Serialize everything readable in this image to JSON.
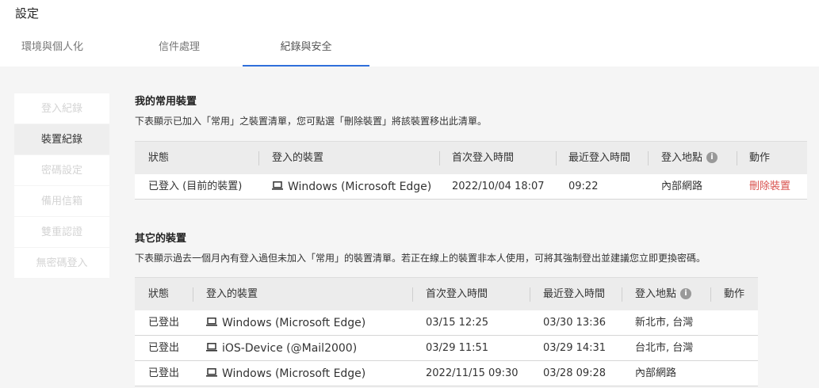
{
  "page_title": "設定",
  "tabs": [
    {
      "label": "環境與個人化"
    },
    {
      "label": "信件處理"
    },
    {
      "label": "紀錄與安全"
    }
  ],
  "side_nav": [
    {
      "label": "登入紀錄"
    },
    {
      "label": "裝置紀錄"
    },
    {
      "label": "密碼設定"
    },
    {
      "label": "備用信箱"
    },
    {
      "label": "雙重認證"
    },
    {
      "label": "無密碼登入"
    }
  ],
  "common": {
    "title": "我的常用裝置",
    "desc": "下表顯示已加入「常用」之裝置清單，您可點選「刪除裝置」將該裝置移出此清單。",
    "headers": {
      "status": "狀態",
      "device": "登入的裝置",
      "first": "首次登入時間",
      "last": "最近登入時間",
      "location": "登入地點",
      "action": "動作"
    },
    "rows": [
      {
        "status": "已登入 (目前的裝置)",
        "device": "Windows (Microsoft Edge)",
        "first": "2022/10/04 18:07",
        "last": "09:22",
        "location": "內部網路",
        "action": "刪除裝置"
      }
    ]
  },
  "other": {
    "title": "其它的裝置",
    "desc": "下表顯示過去一個月內有登入過但未加入「常用」的裝置清單。若正在線上的裝置非本人使用，可將其強制登出並建議您立即更換密碼。",
    "headers": {
      "status": "狀態",
      "device": "登入的裝置",
      "first": "首次登入時間",
      "last": "最近登入時間",
      "location": "登入地點",
      "action": "動作"
    },
    "rows": [
      {
        "status": "已登出",
        "device": "Windows (Microsoft Edge)",
        "first": "03/15 12:25",
        "last": "03/30 13:36",
        "location": "新北市, 台灣"
      },
      {
        "status": "已登出",
        "device": "iOS-Device (@Mail2000)",
        "first": "03/29 11:51",
        "last": "03/29 14:31",
        "location": "台北市, 台灣"
      },
      {
        "status": "已登出",
        "device": "Windows (Microsoft Edge)",
        "first": "2022/11/15 09:30",
        "last": "03/28 09:28",
        "location": "內部網路"
      }
    ]
  },
  "icons": {
    "device": "laptop-icon",
    "info": "info-icon"
  },
  "colors": {
    "accent": "#2f6fdb",
    "danger": "#d9534f",
    "header_bg": "#ececec"
  }
}
